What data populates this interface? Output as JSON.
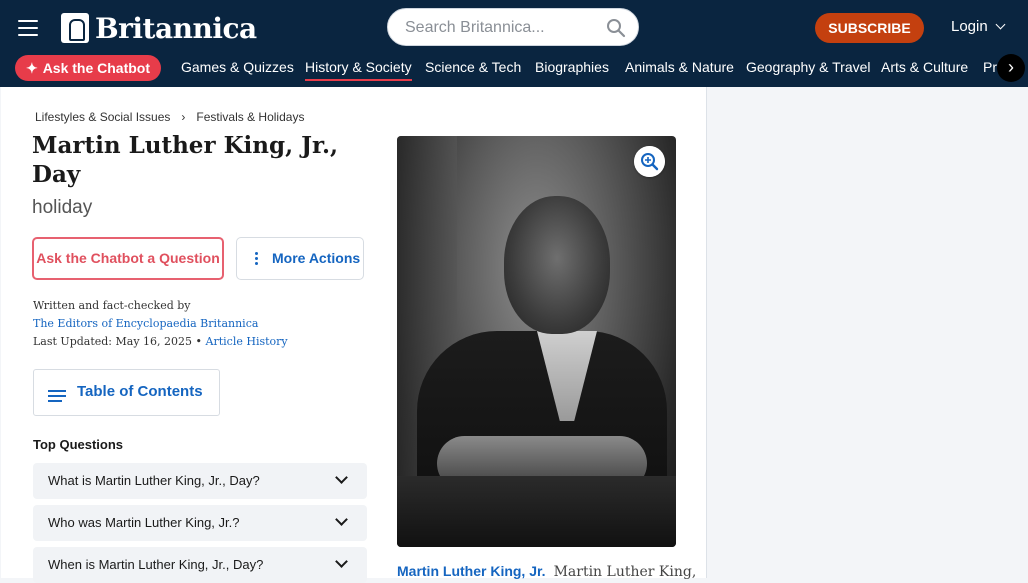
{
  "header": {
    "logo_text": "Britannica",
    "search_placeholder": "Search Britannica...",
    "subscribe_label": "SUBSCRIBE",
    "login_label": "Login"
  },
  "nav": {
    "chatbot_label": "Ask the Chatbot",
    "items": [
      "Games & Quizzes",
      "History & Society",
      "Science & Tech",
      "Biographies",
      "Animals & Nature",
      "Geography & Travel",
      "Arts & Culture",
      "Pro"
    ],
    "active": "History & Society"
  },
  "breadcrumbs": [
    "Lifestyles & Social Issues",
    "Festivals & Holidays"
  ],
  "article": {
    "title": "Martin Luther King, Jr., Day",
    "subtitle": "holiday",
    "ask_button": "Ask the Chatbot a Question",
    "more_actions": "More Actions",
    "written_by_label": "Written and fact-checked by",
    "author": "The Editors of Encyclopaedia Britannica",
    "updated_label": "Last Updated: May 16, 2025",
    "bullet": "•",
    "history_link": "Article History",
    "toc_label": "Table of Contents",
    "top_questions_heading": "Top Questions",
    "questions": [
      "What is Martin Luther King, Jr., Day?",
      "Who was Martin Luther King, Jr.?",
      "When is Martin Luther King, Jr., Day?"
    ]
  },
  "media": {
    "caption_name": "Martin Luther King, Jr.",
    "caption_desc": "Martin Luther King,"
  },
  "colors": {
    "header_bg": "#0a2540",
    "accent_red": "#e73c4a",
    "subscribe": "#c4400f",
    "link_blue": "#1565c0"
  }
}
